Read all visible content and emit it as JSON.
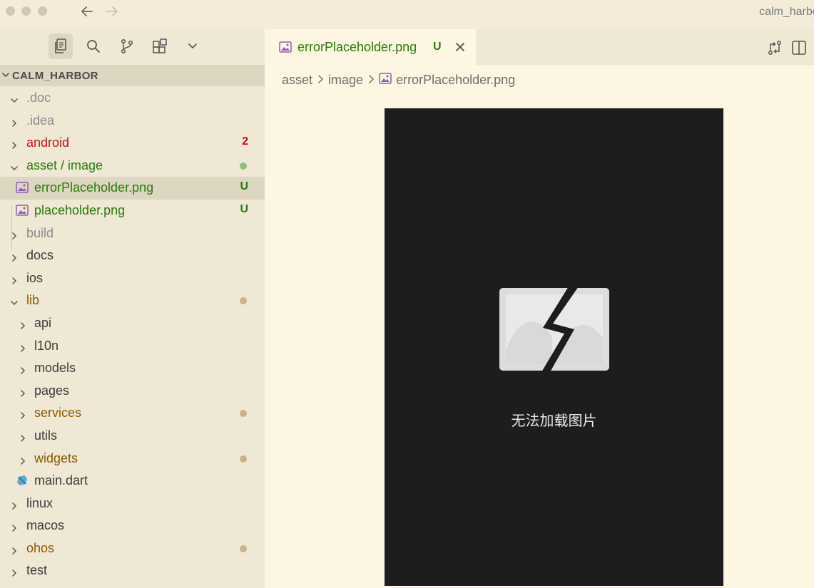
{
  "window": {
    "title": "calm_harbor"
  },
  "sidebar": {
    "explorer_title": "CALM_HARBOR",
    "tree": [
      {
        "label": ".doc",
        "type": "folder",
        "expanded": true,
        "depth": 0,
        "color": "#8a8a8a"
      },
      {
        "label": ".idea",
        "type": "folder",
        "expanded": false,
        "depth": 0,
        "color": "#8a8a8a"
      },
      {
        "label": "android",
        "type": "folder",
        "expanded": false,
        "depth": 0,
        "color": "#c2121d",
        "badge": "2",
        "badge_color": "#c2121d"
      },
      {
        "label": "asset / image",
        "type": "folder",
        "expanded": true,
        "depth": 0,
        "color": "#2a7a0c",
        "dot_color": "#8cbf7d"
      },
      {
        "label": "errorPlaceholder.png",
        "type": "image",
        "depth": 1,
        "color": "#2a7a0c",
        "badge": "U",
        "badge_color": "#2a7a0c",
        "selected": true
      },
      {
        "label": "placeholder.png",
        "type": "image",
        "depth": 1,
        "color": "#2a7a0c",
        "badge": "U",
        "badge_color": "#2a7a0c"
      },
      {
        "label": "build",
        "type": "folder",
        "expanded": false,
        "depth": 0,
        "color": "#8a8a8a"
      },
      {
        "label": "docs",
        "type": "folder",
        "expanded": false,
        "depth": 0,
        "color": "#3b3b3b"
      },
      {
        "label": "ios",
        "type": "folder",
        "expanded": false,
        "depth": 0,
        "color": "#3b3b3b"
      },
      {
        "label": "lib",
        "type": "folder",
        "expanded": true,
        "depth": 0,
        "color": "#8a5a00",
        "dot_color": "#c9b28a"
      },
      {
        "label": "api",
        "type": "folder",
        "expanded": false,
        "depth": 1,
        "color": "#3b3b3b"
      },
      {
        "label": "l10n",
        "type": "folder",
        "expanded": false,
        "depth": 1,
        "color": "#3b3b3b"
      },
      {
        "label": "models",
        "type": "folder",
        "expanded": false,
        "depth": 1,
        "color": "#3b3b3b"
      },
      {
        "label": "pages",
        "type": "folder",
        "expanded": false,
        "depth": 1,
        "color": "#3b3b3b"
      },
      {
        "label": "services",
        "type": "folder",
        "expanded": false,
        "depth": 1,
        "color": "#8a5a00",
        "dot_color": "#c9b28a"
      },
      {
        "label": "utils",
        "type": "folder",
        "expanded": false,
        "depth": 1,
        "color": "#3b3b3b"
      },
      {
        "label": "widgets",
        "type": "folder",
        "expanded": false,
        "depth": 1,
        "color": "#8a5a00",
        "dot_color": "#c9b28a"
      },
      {
        "label": "main.dart",
        "type": "dart",
        "depth": 1,
        "color": "#3b3b3b"
      },
      {
        "label": "linux",
        "type": "folder",
        "expanded": false,
        "depth": 0,
        "color": "#3b3b3b"
      },
      {
        "label": "macos",
        "type": "folder",
        "expanded": false,
        "depth": 0,
        "color": "#3b3b3b"
      },
      {
        "label": "ohos",
        "type": "folder",
        "expanded": false,
        "depth": 0,
        "color": "#8a5a00",
        "dot_color": "#c9b28a"
      },
      {
        "label": "test",
        "type": "folder",
        "expanded": false,
        "depth": 0,
        "color": "#3b3b3b"
      }
    ]
  },
  "editor": {
    "tab": {
      "label": "errorPlaceholder.png",
      "status": "U"
    },
    "breadcrumb": {
      "seg1": "asset",
      "seg2": "image",
      "seg3": "errorPlaceholder.png"
    },
    "preview_message": "无法加载图片"
  },
  "icons": {
    "explorer": "files-icon",
    "search": "search-icon",
    "source_control": "source-control-icon",
    "extensions": "extensions-icon",
    "more": "chevron-down-icon"
  }
}
